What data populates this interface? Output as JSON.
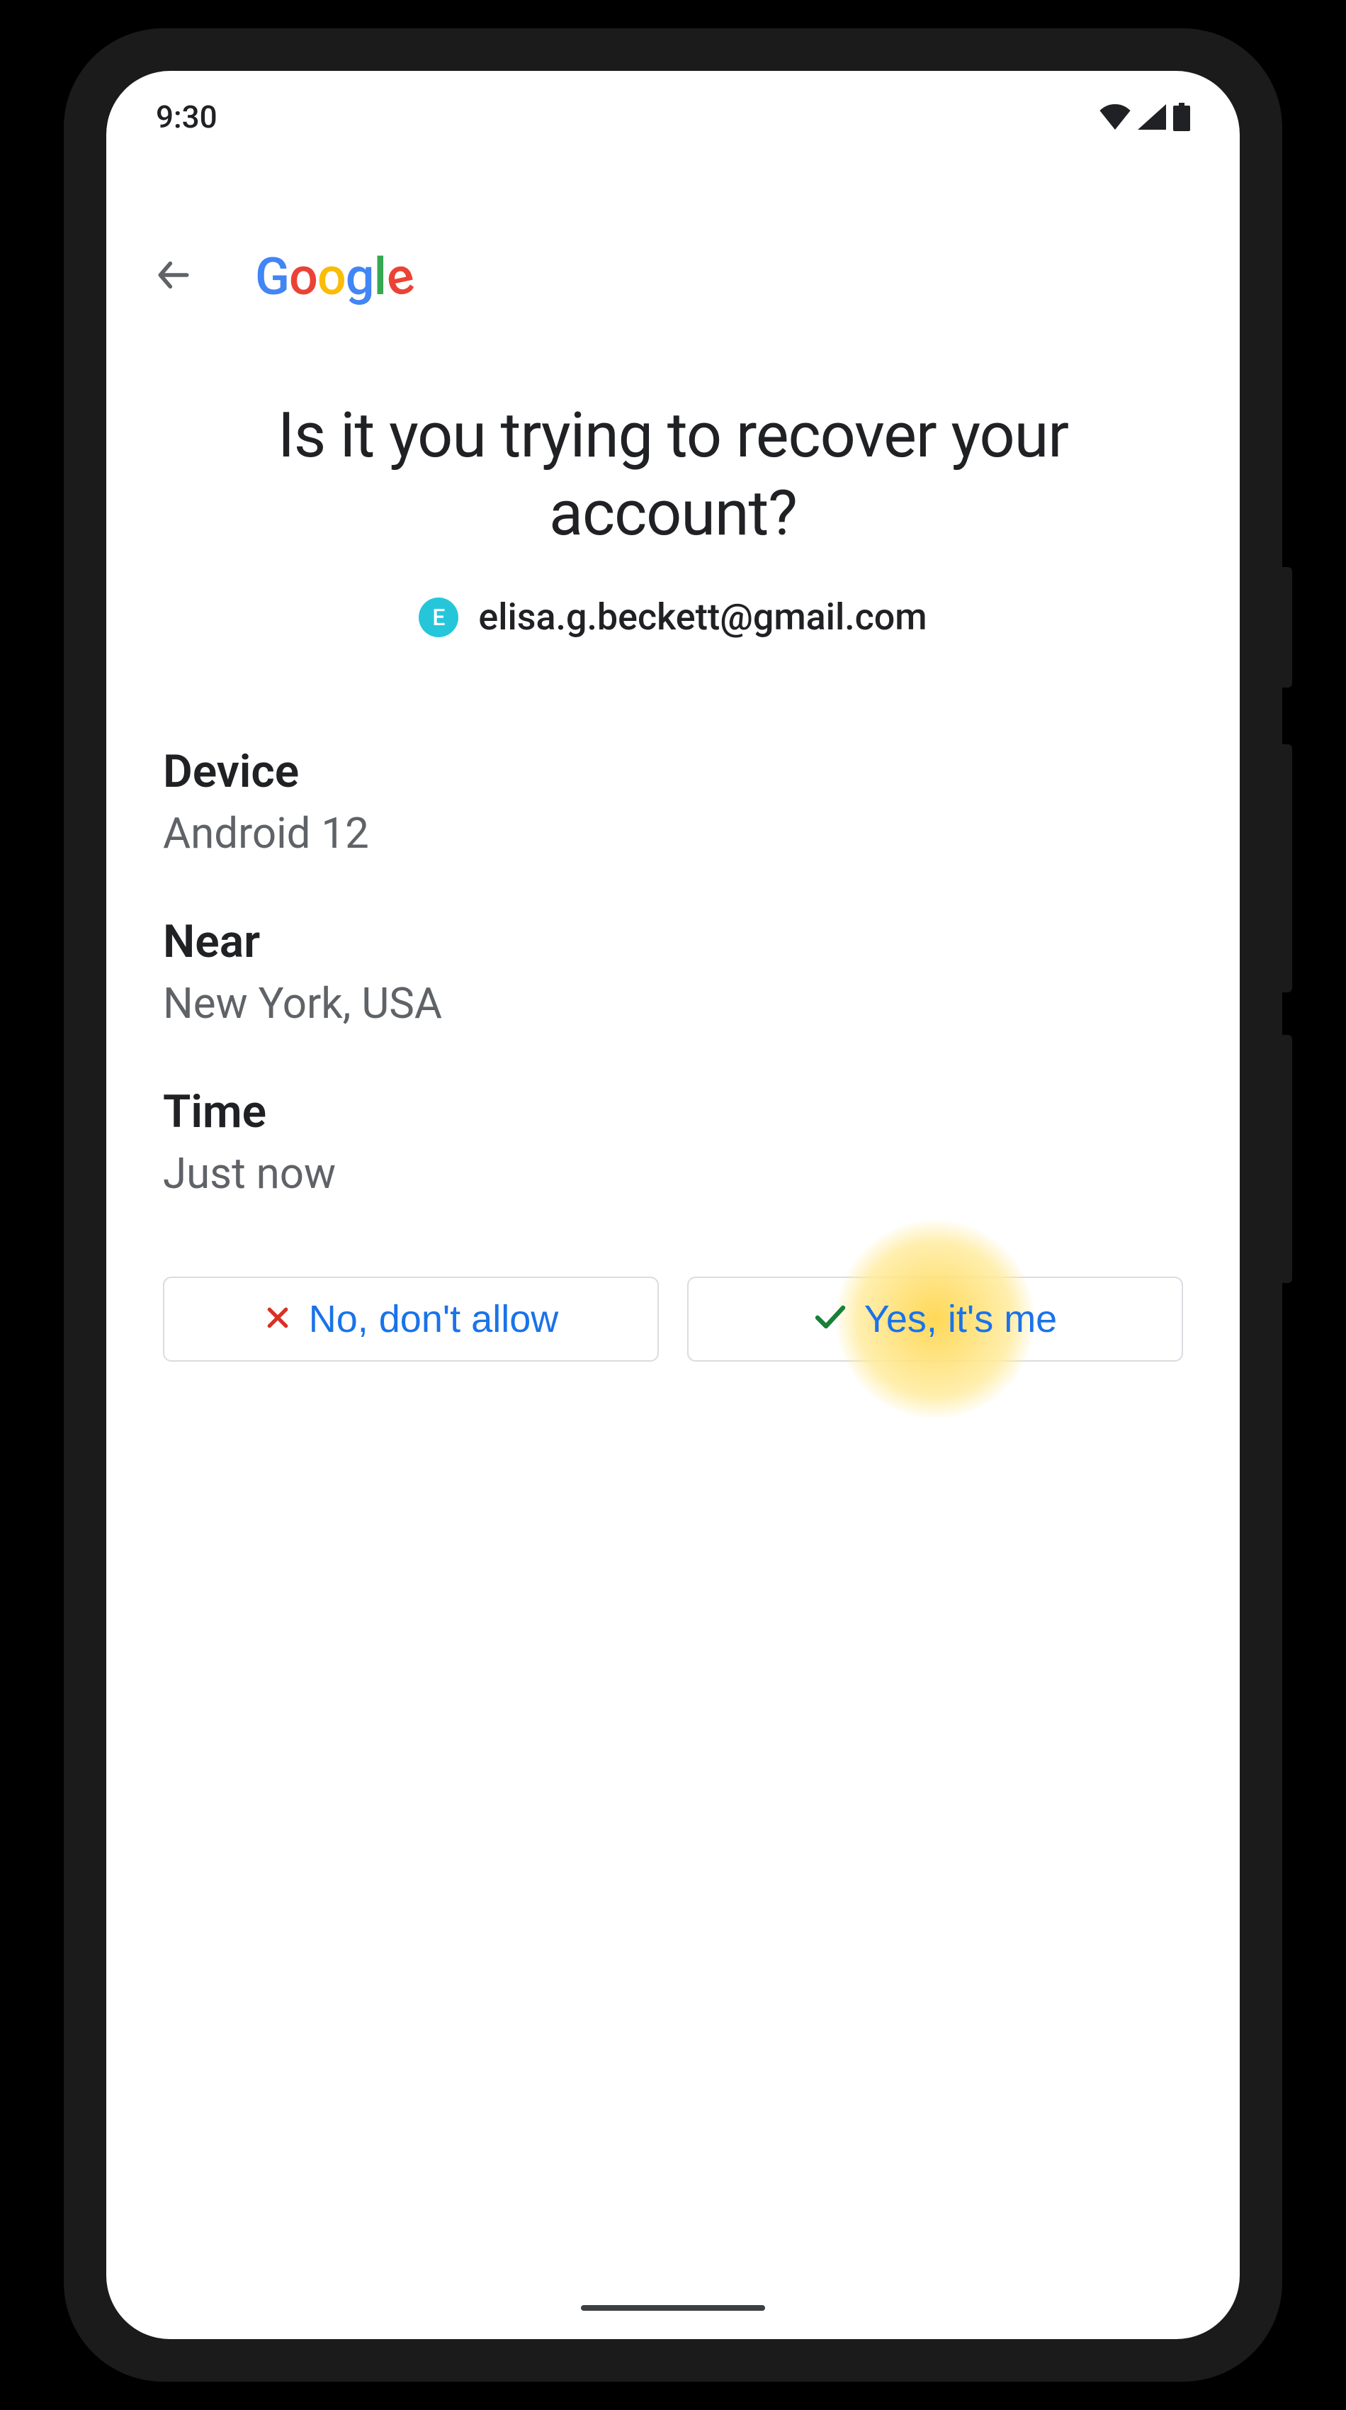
{
  "status": {
    "time": "9:30"
  },
  "header": {
    "brand": "Google"
  },
  "prompt": {
    "title": "Is it you trying to recover your account?",
    "avatar_initial": "E",
    "email": "elisa.g.beckett@gmail.com"
  },
  "details": {
    "device_label": "Device",
    "device_value": "Android 12",
    "near_label": "Near",
    "near_value": "New York, USA",
    "time_label": "Time",
    "time_value": "Just now"
  },
  "actions": {
    "deny_label": "No, don't allow",
    "allow_label": "Yes, it's me"
  },
  "highlight": {
    "target": "allow-button"
  }
}
